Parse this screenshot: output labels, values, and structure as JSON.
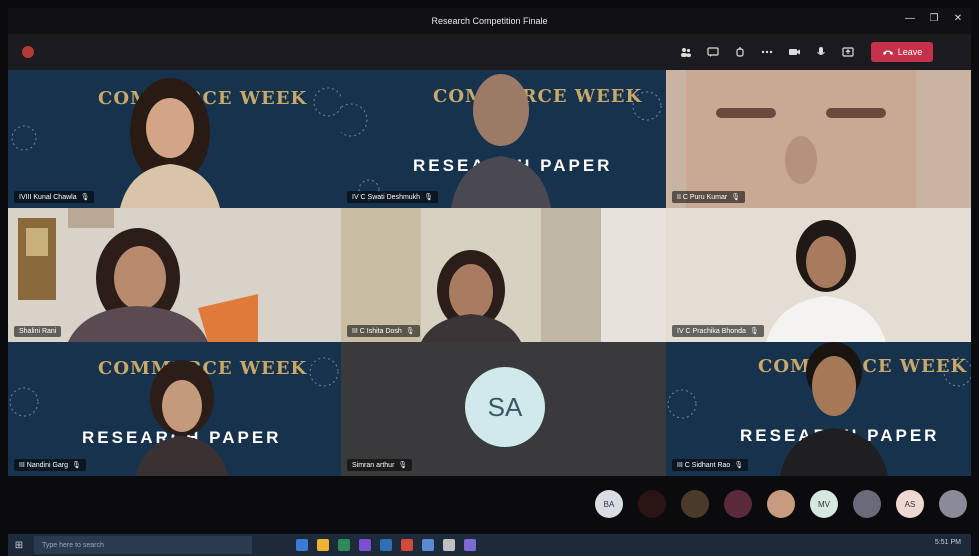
{
  "window": {
    "title": "Research Competition Finale",
    "minimize_glyph": "—",
    "maximize_glyph": "❐",
    "close_glyph": "✕"
  },
  "toolbar": {
    "timer": "",
    "icons": [
      "people-icon",
      "chat-icon",
      "raise-hand-icon",
      "more-icon",
      "camera-icon",
      "mic-icon",
      "share-icon"
    ],
    "leave_label": "Leave",
    "leave_icon": "phone-hangup-icon",
    "leave_color": "#c4314b"
  },
  "tiles": [
    {
      "label": "IVIII Kunal Chawla",
      "bg": "#17324d",
      "brand": "COMMERCE WEEK"
    },
    {
      "label": "IV C Swati Deshmukh",
      "bg": "#17324d",
      "brand": "COMMERCE WEEK",
      "paper": "RESEARCH PAPER"
    },
    {
      "label": "II C Puru Kumar",
      "bg": "#c9b3a2"
    },
    {
      "label": "Shalini Rani",
      "bg": "#d9d2c8"
    },
    {
      "label": "III C Ishita Dosh",
      "bg": "#c8c2b3"
    },
    {
      "label": "IV C Prachika Bhonda",
      "bg": "#e3ddd3"
    },
    {
      "label": "III Nandini Garg",
      "bg": "#17324d",
      "brand": "COMMERCE WEEK",
      "paper": "RESEARCH PAPER"
    },
    {
      "label": "Simran arthur",
      "bg": "#3a3a3d",
      "avatar_initials": "SA",
      "avatar_color": "#cfe9ec"
    },
    {
      "label": "III C Sidhant Rao",
      "bg": "#17324d",
      "brand": "COMMERCE WEEK",
      "paper": "RESEARCH PAPER"
    }
  ],
  "participants_bar": [
    {
      "initials": "BA",
      "color": "#d8dde6"
    },
    {
      "initials": "",
      "color": "#2a1414"
    },
    {
      "initials": "",
      "color": "#4a3a2a"
    },
    {
      "initials": "",
      "color": "#5a2a3a"
    },
    {
      "initials": "",
      "color": "#c89a80"
    },
    {
      "initials": "MV",
      "color": "#d6e8e0"
    },
    {
      "initials": "",
      "color": "#6a6a7a"
    },
    {
      "initials": "AS",
      "color": "#f0d8d2"
    },
    {
      "initials": "",
      "color": "#8a8a9a"
    }
  ],
  "taskbar": {
    "search_placeholder": "Type here to search",
    "start_glyph": "⊞",
    "app_colors": [
      "#3a7bd5",
      "#f2b233",
      "#2e8b57",
      "#7a4fd1",
      "#2f6fb3",
      "#d14a3a",
      "#5a8ad6",
      "#bfbfbf",
      "#7b6ad6"
    ],
    "time": "5:51 PM"
  }
}
